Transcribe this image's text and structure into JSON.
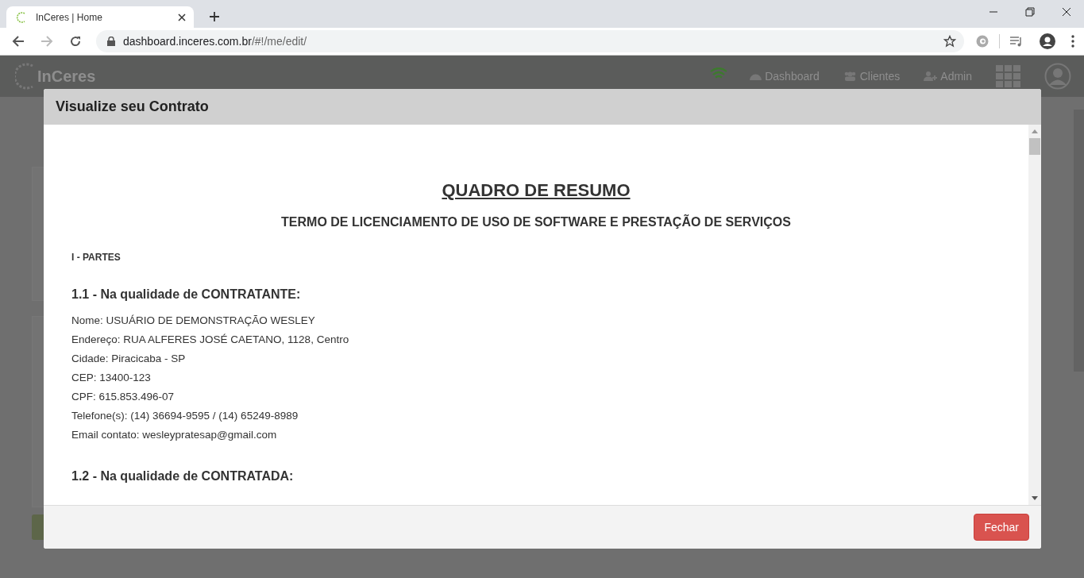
{
  "browser": {
    "tab_title": "InCeres | Home",
    "url_host": "dashboard.inceres.com.br",
    "url_path": "/#!/me/edit/"
  },
  "navbar": {
    "logo": "InCeres",
    "items": [
      {
        "kind": "dashboard",
        "label": "Dashboard"
      },
      {
        "kind": "clients",
        "label": "Clientes"
      },
      {
        "kind": "admin",
        "label": "Admin"
      }
    ]
  },
  "modal": {
    "title": "Visualize seu Contrato",
    "document": {
      "title": "QUADRO DE RESUMO",
      "subtitle": "TERMO DE LICENCIAMENTO DE USO DE SOFTWARE E PRESTAÇÃO DE SERVIÇOS",
      "section": "I - PARTES",
      "parties": [
        {
          "heading": "1.1 - Na qualidade de CONTRATANTE:",
          "lines": [
            "Nome: USUÁRIO DE DEMONSTRAÇÃO WESLEY",
            "Endereço: RUA ALFERES JOSÉ CAETANO, 1128, Centro",
            "Cidade: Piracicaba - SP",
            "CEP: 13400-123",
            "CPF: 615.853.496-07",
            "Telefone(s): (14) 36694-9595 / (14) 65249-8989",
            "Email contato: wesleypratesap@gmail.com"
          ]
        },
        {
          "heading": "1.2 - Na qualidade de CONTRATADA:"
        }
      ]
    },
    "close_button": "Fechar"
  }
}
